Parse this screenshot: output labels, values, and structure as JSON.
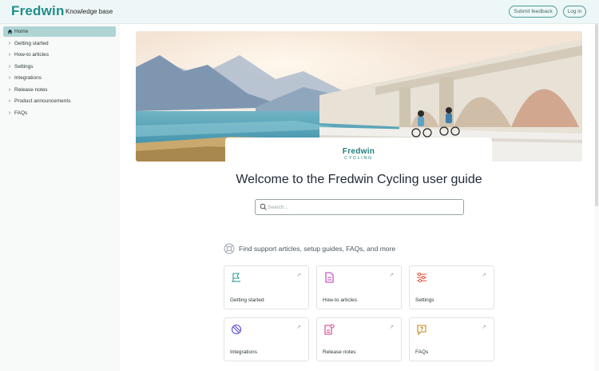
{
  "header": {
    "brand": "Fredwin",
    "subtitle": "Knowledge base",
    "feedback_label": "Submit feedback",
    "login_label": "Log in"
  },
  "sidebar": {
    "items": [
      {
        "label": "Home",
        "icon": "home-icon",
        "active": true
      },
      {
        "label": "Getting started",
        "icon": "chevron-right-icon"
      },
      {
        "label": "How-to articles",
        "icon": "chevron-right-icon"
      },
      {
        "label": "Settings",
        "icon": "chevron-right-icon"
      },
      {
        "label": "Integrations",
        "icon": "chevron-right-icon"
      },
      {
        "label": "Release notes",
        "icon": "chevron-right-icon"
      },
      {
        "label": "Product announcements",
        "icon": "chevron-right-icon"
      },
      {
        "label": "FAQs",
        "icon": "chevron-right-icon"
      }
    ]
  },
  "hero": {
    "logo_main": "Fredwin",
    "logo_sub": "CYCLING"
  },
  "main": {
    "welcome": "Welcome to the Fredwin Cycling user guide",
    "search_placeholder": "Search...",
    "support_text": "Find support articles, setup guides, FAQs, and more",
    "cards": [
      {
        "label": "Getting started",
        "icon": "flag-icon",
        "color": "#2a9d8f"
      },
      {
        "label": "How-to articles",
        "icon": "document-icon",
        "color": "#b83ab8"
      },
      {
        "label": "Settings",
        "icon": "sliders-icon",
        "color": "#e2553f"
      },
      {
        "label": "Integrations",
        "icon": "link-icon",
        "color": "#5a4bd1"
      },
      {
        "label": "Release notes",
        "icon": "notes-icon",
        "color": "#d63a8c"
      },
      {
        "label": "FAQs",
        "icon": "chat-question-icon",
        "color": "#c9831a"
      }
    ]
  },
  "colors": {
    "brand": "#1f8e8a",
    "header_bg": "#eef7f7",
    "active_nav": "#aed5d3"
  }
}
